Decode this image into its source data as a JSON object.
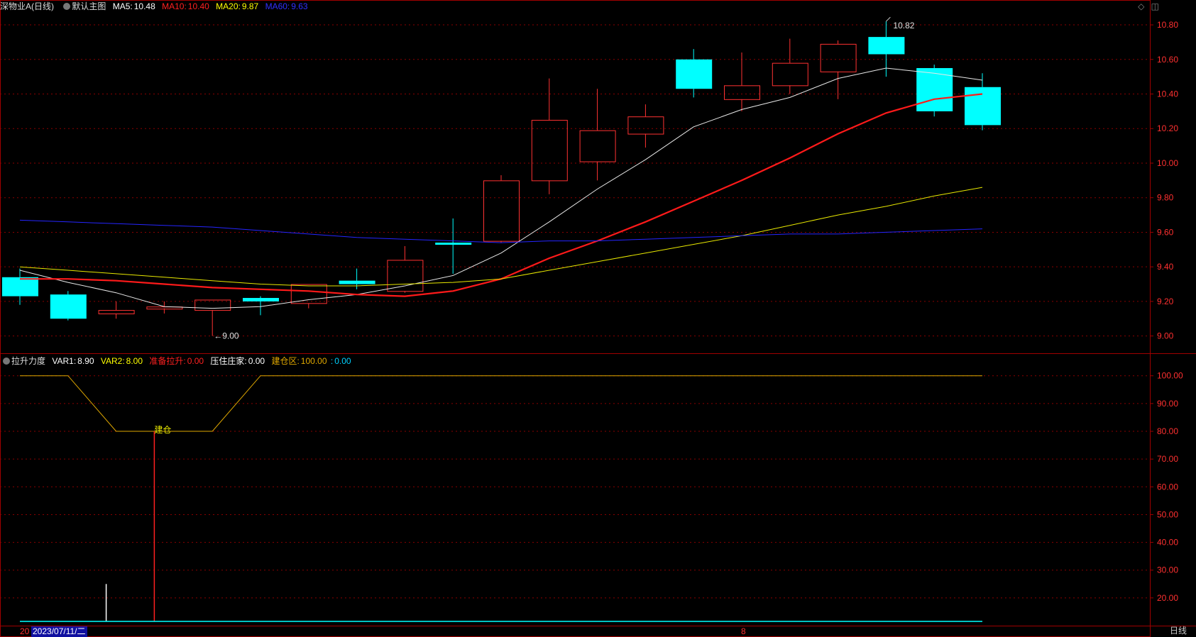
{
  "main_header": {
    "stock_name": "深物业A",
    "period": "(日线)",
    "template": "默认主图",
    "ma5": {
      "label": "MA5:",
      "value": "10.48",
      "color": "#ffffff"
    },
    "ma10": {
      "label": "MA10:",
      "value": "10.40",
      "color": "#ff2020"
    },
    "ma20": {
      "label": "MA20:",
      "value": "9.87",
      "color": "#ffff00"
    },
    "ma60": {
      "label": "MA60:",
      "value": "9.63",
      "color": "#2020ff"
    }
  },
  "top_icons": {
    "diamond": "◇",
    "pane": "◫"
  },
  "indicator_header": {
    "name": "拉升力度",
    "var1": {
      "label": "VAR1:",
      "value": "8.90"
    },
    "var2": {
      "label": "VAR2:",
      "value": "8.00"
    },
    "rise": {
      "label": "准备拉升:",
      "value": "0.00"
    },
    "hold": {
      "label": "压住庄家:",
      "value": "0.00"
    },
    "build": {
      "label": "建仓区:",
      "value": "100.00"
    },
    "extra": {
      "label": ":",
      "value": "0.00"
    }
  },
  "annotations": {
    "max_price": "10.82",
    "min_price": "←9.00",
    "build_signal": "建仓"
  },
  "price_axis": {
    "ticks": [
      "10.80",
      "10.60",
      "10.40",
      "10.20",
      "10.00",
      "9.80",
      "9.60",
      "9.40",
      "9.20",
      "9.00"
    ]
  },
  "indicator_axis": {
    "ticks": [
      "100.00",
      "90.00",
      "80.00",
      "70.00",
      "60.00",
      "50.00",
      "40.00",
      "30.00",
      "20.00"
    ]
  },
  "bottom_bar": {
    "date_prefix": "20",
    "date": "2023/07/11/二",
    "month_mark": "8",
    "period_button": "日线"
  },
  "colors": {
    "up": "#ff3232",
    "down": "#00ffff",
    "grid": "#8b0000",
    "axis": "#a00000"
  },
  "chart_data": [
    {
      "type": "candlestick",
      "ylim": [
        8.9,
        10.87
      ],
      "candles": [
        {
          "o": 9.34,
          "h": 9.39,
          "l": 9.18,
          "c": 9.23
        },
        {
          "o": 9.24,
          "h": 9.26,
          "l": 9.09,
          "c": 9.1
        },
        {
          "o": 9.13,
          "h": 9.2,
          "l": 9.1,
          "c": 9.15
        },
        {
          "o": 9.16,
          "h": 9.2,
          "l": 9.13,
          "c": 9.17
        },
        {
          "o": 9.15,
          "h": 9.21,
          "l": 9.0,
          "c": 9.21
        },
        {
          "o": 9.22,
          "h": 9.23,
          "l": 9.12,
          "c": 9.2
        },
        {
          "o": 9.19,
          "h": 9.3,
          "l": 9.16,
          "c": 9.3
        },
        {
          "o": 9.32,
          "h": 9.39,
          "l": 9.27,
          "c": 9.3
        },
        {
          "o": 9.26,
          "h": 9.52,
          "l": 9.25,
          "c": 9.44
        },
        {
          "o": 9.54,
          "h": 9.68,
          "l": 9.36,
          "c": 9.53
        },
        {
          "o": 9.55,
          "h": 9.93,
          "l": 9.54,
          "c": 9.9
        },
        {
          "o": 9.9,
          "h": 10.49,
          "l": 9.82,
          "c": 10.25
        },
        {
          "o": 10.01,
          "h": 10.43,
          "l": 9.9,
          "c": 10.19
        },
        {
          "o": 10.17,
          "h": 10.34,
          "l": 10.09,
          "c": 10.27
        },
        {
          "o": 10.6,
          "h": 10.66,
          "l": 10.38,
          "c": 10.43
        },
        {
          "o": 10.37,
          "h": 10.64,
          "l": 10.3,
          "c": 10.45
        },
        {
          "o": 10.45,
          "h": 10.72,
          "l": 10.4,
          "c": 10.58
        },
        {
          "o": 10.53,
          "h": 10.71,
          "l": 10.37,
          "c": 10.69
        },
        {
          "o": 10.73,
          "h": 10.82,
          "l": 10.5,
          "c": 10.63
        },
        {
          "o": 10.55,
          "h": 10.57,
          "l": 10.27,
          "c": 10.3
        },
        {
          "o": 10.44,
          "h": 10.52,
          "l": 10.19,
          "c": 10.22
        }
      ],
      "series": [
        {
          "name": "MA5",
          "color": "#e8e8e8",
          "width": 1,
          "start": 0,
          "values": [
            9.38,
            9.31,
            9.25,
            9.17,
            9.16,
            9.17,
            9.21,
            9.24,
            9.29,
            9.35,
            9.48,
            9.66,
            9.85,
            10.02,
            10.21,
            10.31,
            10.38,
            10.49,
            10.55,
            10.52,
            10.48
          ]
        },
        {
          "name": "MA10",
          "color": "#ff1a1a",
          "width": 2.2,
          "start": 0,
          "values": [
            9.33,
            9.33,
            9.32,
            9.3,
            9.28,
            9.27,
            9.26,
            9.24,
            9.23,
            9.26,
            9.33,
            9.45,
            9.55,
            9.66,
            9.78,
            9.9,
            10.03,
            10.17,
            10.29,
            10.37,
            10.4
          ]
        },
        {
          "name": "MA20",
          "color": "#e8e800",
          "width": 1,
          "start": 0,
          "values": [
            9.4,
            9.38,
            9.36,
            9.34,
            9.32,
            9.3,
            9.29,
            9.29,
            9.3,
            9.31,
            9.33,
            9.38,
            9.43,
            9.48,
            9.53,
            9.58,
            9.64,
            9.7,
            9.75,
            9.81,
            9.86
          ]
        },
        {
          "name": "MA60",
          "color": "#2525ff",
          "width": 1,
          "start": 0,
          "values": [
            9.67,
            9.66,
            9.65,
            9.64,
            9.63,
            9.61,
            9.59,
            9.57,
            9.56,
            9.55,
            9.54,
            9.55,
            9.55,
            9.56,
            9.57,
            9.58,
            9.59,
            9.59,
            9.6,
            9.61,
            9.62
          ]
        }
      ]
    },
    {
      "type": "line",
      "ylim": [
        10,
        103
      ],
      "series": [
        {
          "name": "建仓区",
          "color": "#e0a800",
          "values": [
            100,
            100,
            80,
            80,
            80,
            100,
            100,
            100,
            100,
            100,
            100,
            100,
            100,
            100,
            100,
            100,
            100,
            100,
            100,
            100,
            100
          ]
        }
      ],
      "bars": [
        {
          "index": 2,
          "value": 25,
          "color": "#ffffff"
        },
        {
          "index": 3,
          "value": 80,
          "color": "#ff2020"
        }
      ],
      "baseline_color": "#00ffff"
    }
  ]
}
